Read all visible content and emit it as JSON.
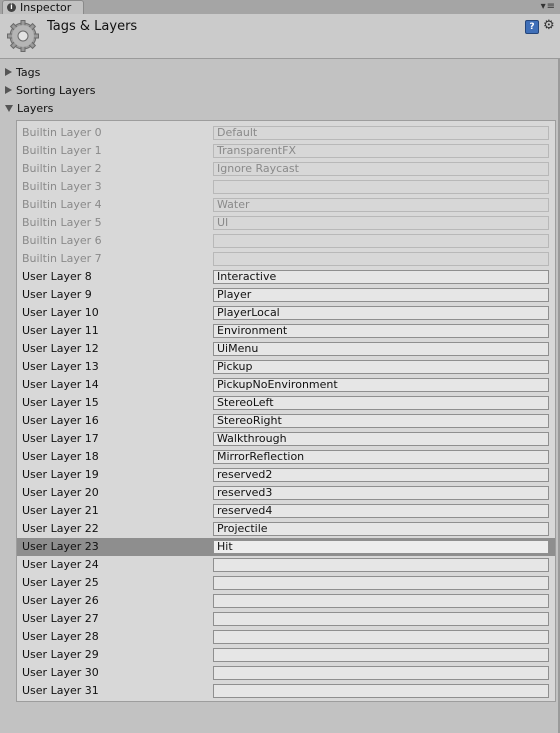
{
  "tab": {
    "label": "Inspector",
    "icon": "info-icon"
  },
  "header": {
    "title": "Tags & Layers",
    "help_icon": "?",
    "settings_icon": "⚙"
  },
  "foldouts": [
    {
      "label": "Tags",
      "expanded": false
    },
    {
      "label": "Sorting Layers",
      "expanded": false
    },
    {
      "label": "Layers",
      "expanded": true
    }
  ],
  "layers": [
    {
      "label": "Builtin Layer 0",
      "value": "Default",
      "builtin": true
    },
    {
      "label": "Builtin Layer 1",
      "value": "TransparentFX",
      "builtin": true
    },
    {
      "label": "Builtin Layer 2",
      "value": "Ignore Raycast",
      "builtin": true
    },
    {
      "label": "Builtin Layer 3",
      "value": "",
      "builtin": true
    },
    {
      "label": "Builtin Layer 4",
      "value": "Water",
      "builtin": true
    },
    {
      "label": "Builtin Layer 5",
      "value": "UI",
      "builtin": true
    },
    {
      "label": "Builtin Layer 6",
      "value": "",
      "builtin": true
    },
    {
      "label": "Builtin Layer 7",
      "value": "",
      "builtin": true
    },
    {
      "label": "User Layer 8",
      "value": "Interactive",
      "builtin": false
    },
    {
      "label": "User Layer 9",
      "value": "Player",
      "builtin": false
    },
    {
      "label": "User Layer 10",
      "value": "PlayerLocal",
      "builtin": false
    },
    {
      "label": "User Layer 11",
      "value": "Environment",
      "builtin": false
    },
    {
      "label": "User Layer 12",
      "value": "UiMenu",
      "builtin": false
    },
    {
      "label": "User Layer 13",
      "value": "Pickup",
      "builtin": false
    },
    {
      "label": "User Layer 14",
      "value": "PickupNoEnvironment",
      "builtin": false
    },
    {
      "label": "User Layer 15",
      "value": "StereoLeft",
      "builtin": false
    },
    {
      "label": "User Layer 16",
      "value": "StereoRight",
      "builtin": false
    },
    {
      "label": "User Layer 17",
      "value": "Walkthrough",
      "builtin": false
    },
    {
      "label": "User Layer 18",
      "value": "MirrorReflection",
      "builtin": false
    },
    {
      "label": "User Layer 19",
      "value": "reserved2",
      "builtin": false
    },
    {
      "label": "User Layer 20",
      "value": "reserved3",
      "builtin": false
    },
    {
      "label": "User Layer 21",
      "value": "reserved4",
      "builtin": false
    },
    {
      "label": "User Layer 22",
      "value": "Projectile",
      "builtin": false
    },
    {
      "label": "User Layer 23",
      "value": "Hit",
      "builtin": false,
      "selected": true
    },
    {
      "label": "User Layer 24",
      "value": "",
      "builtin": false
    },
    {
      "label": "User Layer 25",
      "value": "",
      "builtin": false
    },
    {
      "label": "User Layer 26",
      "value": "",
      "builtin": false
    },
    {
      "label": "User Layer 27",
      "value": "",
      "builtin": false
    },
    {
      "label": "User Layer 28",
      "value": "",
      "builtin": false
    },
    {
      "label": "User Layer 29",
      "value": "",
      "builtin": false
    },
    {
      "label": "User Layer 30",
      "value": "",
      "builtin": false
    },
    {
      "label": "User Layer 31",
      "value": "",
      "builtin": false
    }
  ]
}
